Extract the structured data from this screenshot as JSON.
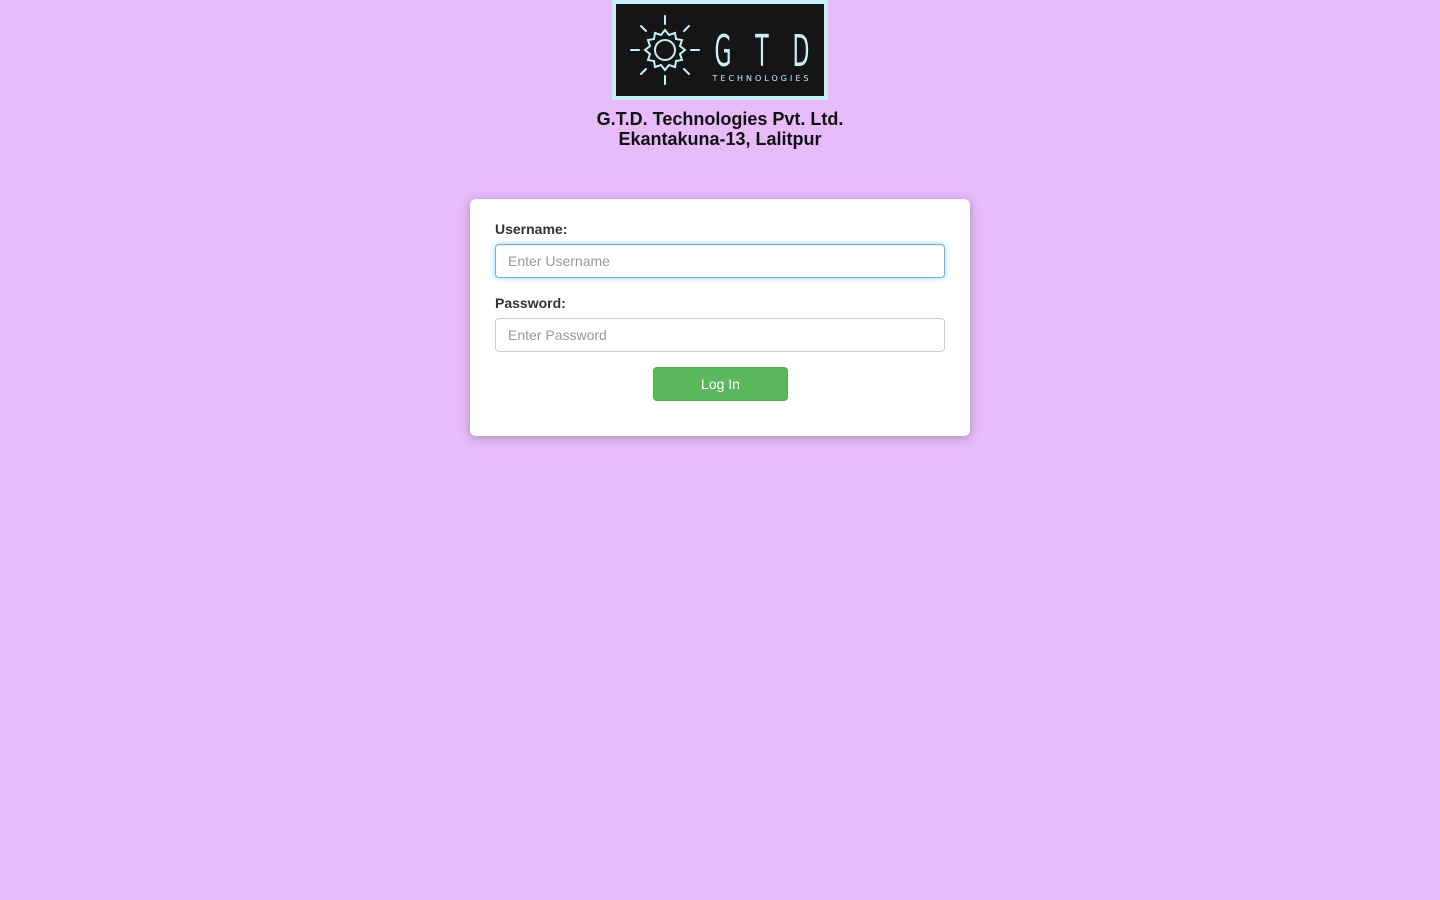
{
  "brand": {
    "logo_icon": "gear-icon",
    "logo_letters": [
      "G",
      "T",
      "D"
    ],
    "logo_subtext": "TECHNOLOGIES",
    "logo_color": "#c6f1fb",
    "logo_background": "#151515"
  },
  "company": {
    "name": "G.T.D. Technologies Pvt. Ltd.",
    "address": "Ekantakuna-13, Lalitpur"
  },
  "login_form": {
    "username_label": "Username:",
    "username_placeholder": "Enter Username",
    "username_value": "",
    "password_label": "Password:",
    "password_placeholder": "Enter Password",
    "password_value": "",
    "submit_label": "Log In"
  },
  "colors": {
    "page_background": "#e8bbfb",
    "card_background": "#ffffff",
    "button_background": "#5cb85c",
    "focus_border": "#66afe9"
  }
}
